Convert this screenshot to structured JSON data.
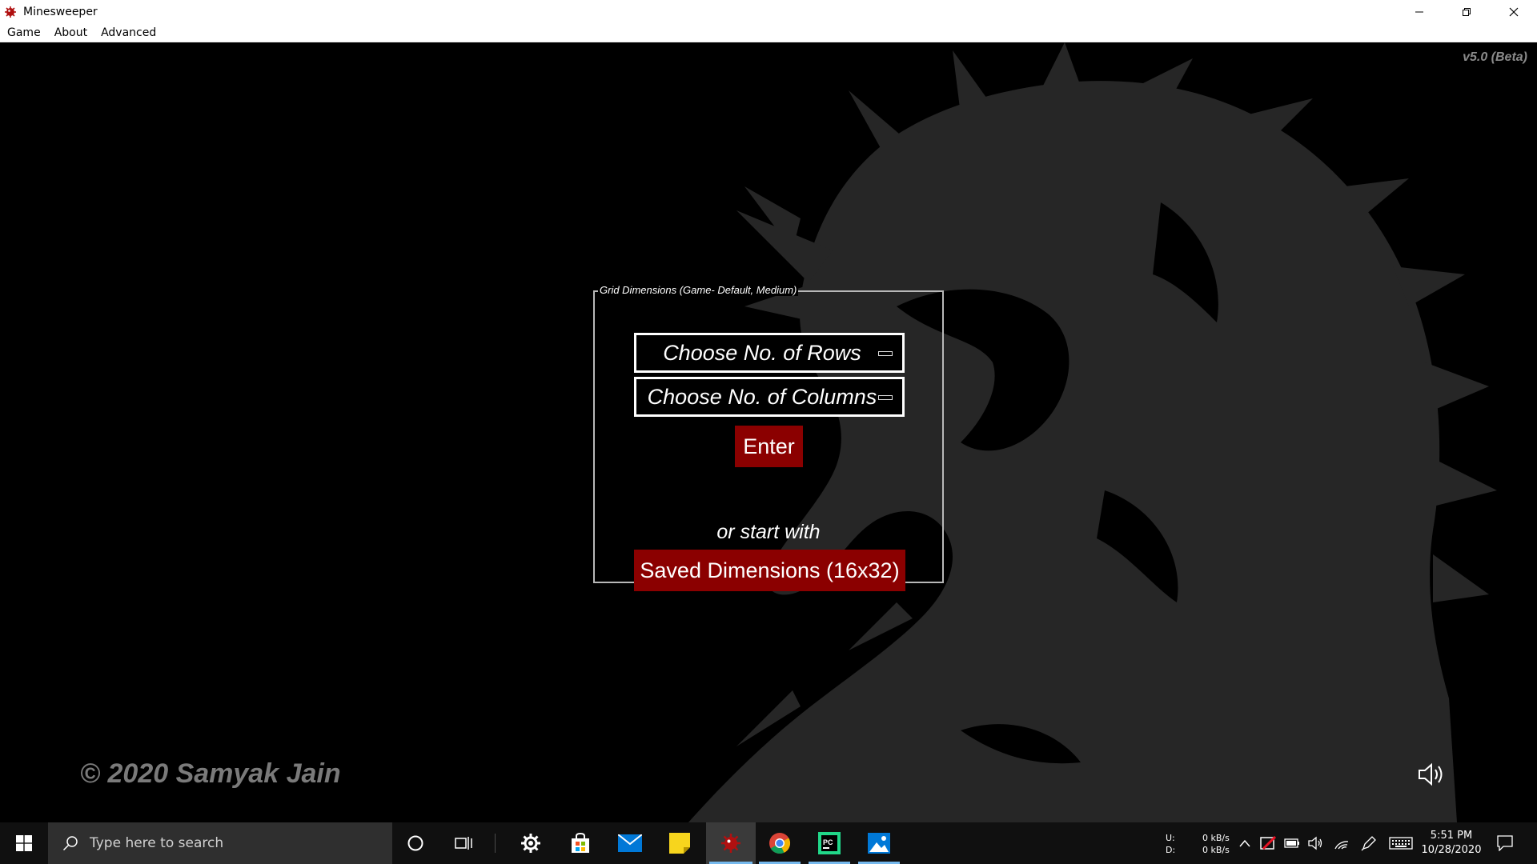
{
  "window": {
    "title": "Minesweeper"
  },
  "menubar": {
    "items": [
      "Game",
      "About",
      "Advanced"
    ]
  },
  "version": "v5.0 (Beta)",
  "panel": {
    "legend": "Grid Dimensions (Game- Default, Medium)",
    "rows_placeholder": "Choose No. of Rows",
    "cols_placeholder": "Choose No. of Columns",
    "enter_label": "Enter",
    "or_text": "or start with",
    "saved_label": "Saved Dimensions (16x32)"
  },
  "copyright": "© 2020 Samyak Jain",
  "taskbar": {
    "search_placeholder": "Type here to search",
    "network": {
      "up_label": "U:",
      "down_label": "D:",
      "up_value": "0 kB/s",
      "down_value": "0 kB/s"
    },
    "clock": {
      "time": "5:51 PM",
      "date": "10/28/2020"
    }
  },
  "colors": {
    "accent_red": "#8b0000",
    "dragon_gray": "#262626",
    "taskbar": "#101010"
  }
}
